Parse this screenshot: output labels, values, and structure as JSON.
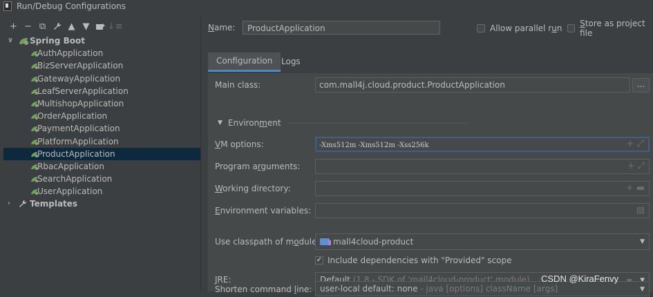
{
  "window": {
    "title": "Run/Debug Configurations"
  },
  "toolbar": {
    "add": "+",
    "remove": "−",
    "copy": "⧉",
    "edit": "🔧",
    "up": "▲",
    "down": "▼",
    "move": "▤",
    "sort": "↓≡"
  },
  "tree": {
    "spring_boot_label": "Spring Boot",
    "items": [
      "AuthApplication",
      "BizServerApplication",
      "GatewayApplication",
      "LeafServerApplication",
      "MultishopApplication",
      "OrderApplication",
      "PaymentApplication",
      "PlatformApplication",
      "ProductApplication",
      "RbacApplication",
      "SearchApplication",
      "UserApplication"
    ],
    "selected": "ProductApplication",
    "templates_label": "Templates"
  },
  "form": {
    "name_label_pre": "N",
    "name_label_post": "ame:",
    "name_value": "ProductApplication",
    "allow_parallel_pre": "Allow parallel r",
    "allow_parallel_u": "u",
    "allow_parallel_post": "n",
    "store_pre": "",
    "store_u": "S",
    "store_post": "tore as project file",
    "tabs": [
      "Configuration",
      "Logs"
    ],
    "main_class_label": "Main class:",
    "main_class_value": "com.mall4j.cloud.product.ProductApplication",
    "dots": "...",
    "environment_pre": "Environ",
    "environment_u": "m",
    "environment_post": "ent",
    "vm_label_u": "V",
    "vm_label_post": "M options:",
    "vm_value": "-Xms512m -Xms512m -Xss256k",
    "prog_pre": "Program a",
    "prog_u": "r",
    "prog_post": "guments:",
    "workdir_u": "W",
    "workdir_post": "orking directory:",
    "env_vars_u": "E",
    "env_vars_post": "nvironment variables:",
    "classpath_pre": "Use classpath of m",
    "classpath_u": "o",
    "classpath_post": "dule:",
    "classpath_value": "mall4cloud-product",
    "include_deps": "Include dependencies with \"Provided\" scope",
    "jre_u": "J",
    "jre_post": "RE:",
    "jre_value_main": "Default",
    "jre_value_gray": "(1.8 - SDK of 'mall4cloud-product' module)",
    "shorten_pre": "Shorten command ",
    "shorten_u": "l",
    "shorten_post": "ine:",
    "shorten_value_main": "user-local default: none",
    "shorten_value_gray": "- java [options] className [args]"
  },
  "watermark": "CSDN @KiraFenvy"
}
